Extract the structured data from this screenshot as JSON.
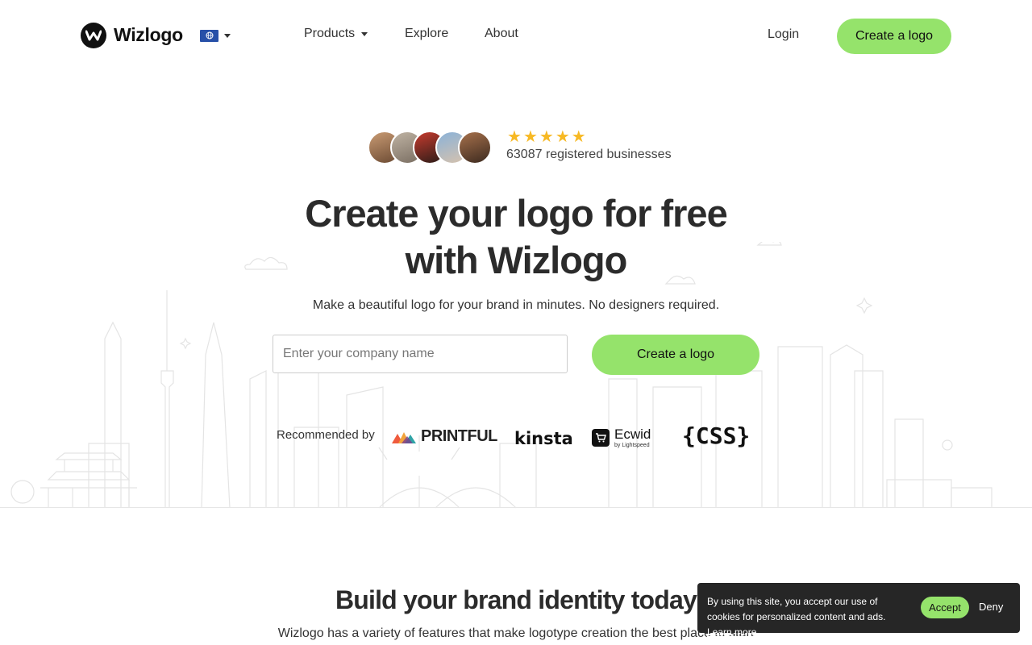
{
  "header": {
    "brand": "Wizlogo",
    "language_icon": "globe-flag-icon",
    "nav": [
      {
        "label": "Products",
        "has_dropdown": true
      },
      {
        "label": "Explore"
      },
      {
        "label": "About"
      }
    ],
    "login_label": "Login",
    "cta_label": "Create a logo"
  },
  "hero": {
    "rating_stars": 5,
    "registered_text": "63087 registered businesses",
    "title_line1": "Create your logo for free",
    "title_line2": "with Wizlogo",
    "subtitle": "Make a beautiful logo for your brand in minutes. No designers required.",
    "input_placeholder": "Enter your company name",
    "cta_label": "Create a logo",
    "recommended_label": "Recommended by",
    "partners": [
      {
        "name": "PRINTFUL"
      },
      {
        "name": "kinsta"
      },
      {
        "name": "Ecwid",
        "sub": "by Lightspeed"
      },
      {
        "name": "{CSS}"
      }
    ]
  },
  "section": {
    "title": "Build your brand identity today",
    "subtitle": "Wizlogo has a variety of features that make logotype creation the best place to start"
  },
  "cookie": {
    "text": "By using this site, you accept our use of cookies for personalized content and ads.",
    "link_label": "Learn more",
    "accept_label": "Accept",
    "deny_label": "Deny"
  },
  "colors": {
    "accent": "#95e36b",
    "star": "#f7b924",
    "cookie_bg": "#262626"
  }
}
